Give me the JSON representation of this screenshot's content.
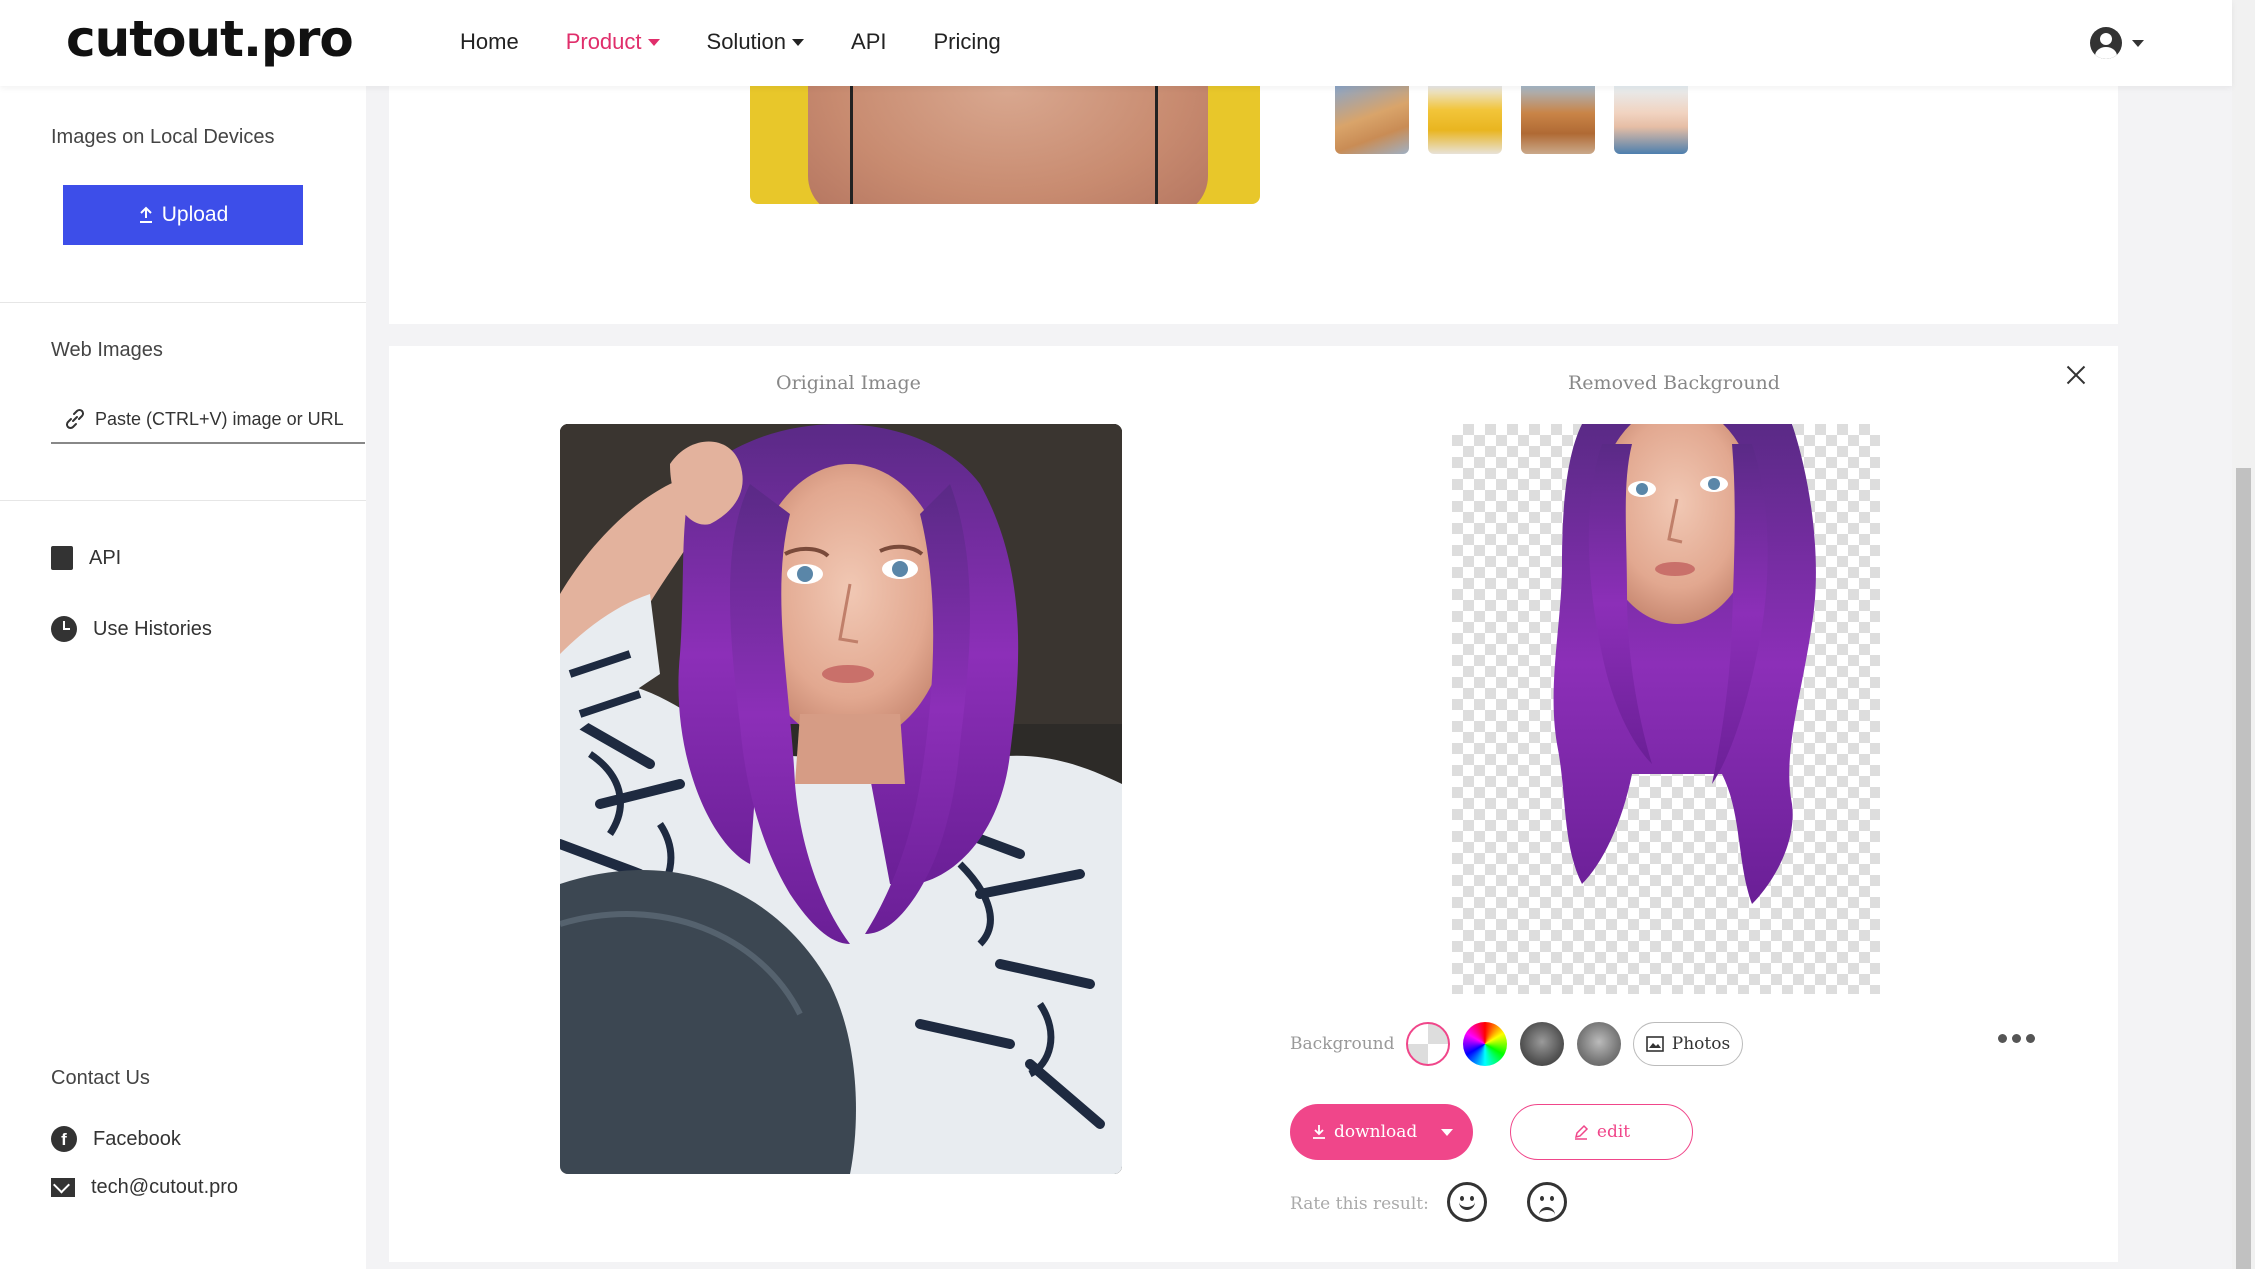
{
  "header": {
    "logo": "cutout.pro",
    "nav": [
      {
        "label": "Home"
      },
      {
        "label": "Product"
      },
      {
        "label": "Solution"
      },
      {
        "label": "API"
      },
      {
        "label": "Pricing"
      }
    ]
  },
  "sidebar": {
    "local_title": "Images on Local Devices",
    "upload_label": "Upload",
    "web_title": "Web Images",
    "paste_placeholder": "Paste (CTRL+V) image or URL",
    "links": [
      {
        "label": "API"
      },
      {
        "label": "Use Histories"
      }
    ],
    "contact_title": "Contact Us",
    "contacts": [
      {
        "label": "Facebook"
      },
      {
        "label": "tech@cutout.pro"
      }
    ]
  },
  "result": {
    "original_label": "Original Image",
    "removed_label": "Removed Background",
    "background_label": "Background",
    "photos_label": "Photos",
    "download_label": "download",
    "edit_label": "edit",
    "rate_label": "Rate this result:"
  },
  "colors": {
    "brand_pink": "#f0468a",
    "upload_blue": "#3d4ee9",
    "nav_active": "#e02e6b"
  }
}
